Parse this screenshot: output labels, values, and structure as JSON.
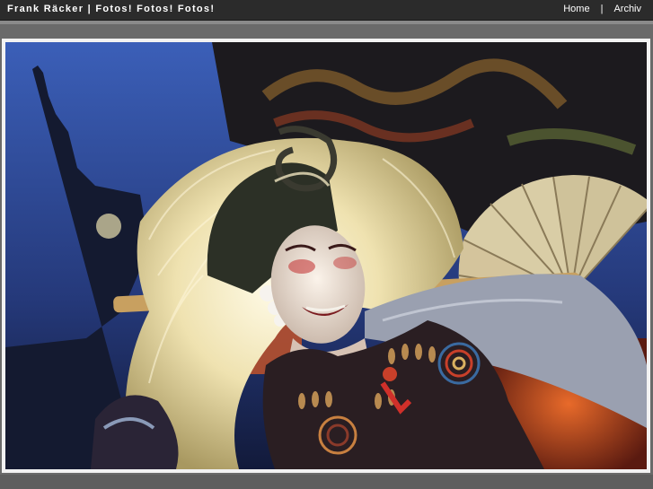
{
  "header": {
    "site_title": "Frank Räcker | Fotos! Fotos! Fotos!",
    "nav": [
      {
        "label": "Home"
      },
      {
        "label": "Archiv"
      }
    ],
    "separator": "|"
  },
  "photo": {
    "subject": "costumed performer with white feathered headdress and paper fan at night",
    "colors": {
      "sky": "#2f4a9a",
      "feathers": "#f3edcf",
      "costume": "#2a1e22",
      "accent": "#c8402a"
    }
  }
}
